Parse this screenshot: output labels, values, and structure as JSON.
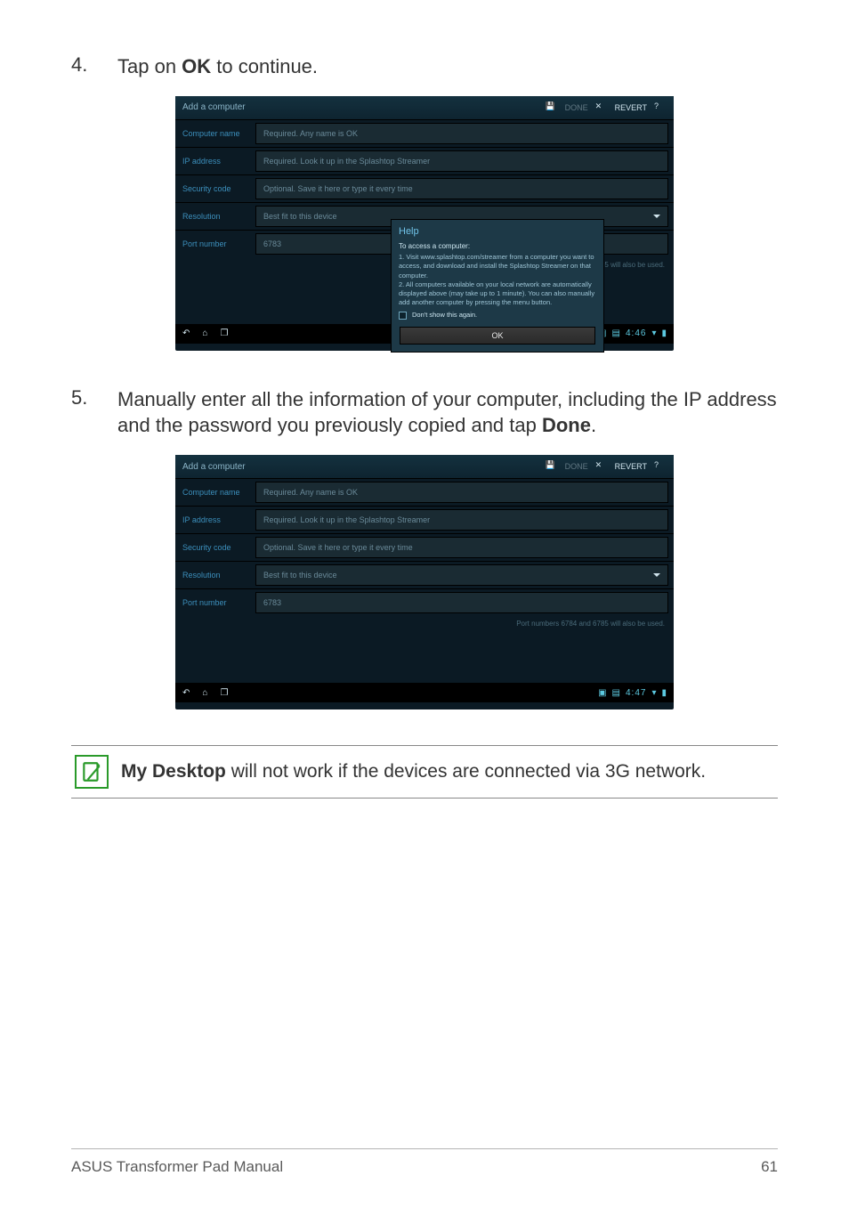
{
  "step4": {
    "num": "4.",
    "text_before": "Tap on ",
    "bold": "OK",
    "text_after": " to continue."
  },
  "step5": {
    "num": "5.",
    "text_before": "Manually enter all the information of your computer, including the IP address and the password you previously copied and tap ",
    "bold": "Done",
    "text_after": "."
  },
  "shot": {
    "title": "Add a computer",
    "save_icon": "💾",
    "done_label": "DONE",
    "revert_label": "REVERT",
    "help_label": "?",
    "x_label": "✕",
    "rows": {
      "computer_name": {
        "label": "Computer name",
        "placeholder": "Required. Any name is OK"
      },
      "ip_address": {
        "label": "IP address",
        "placeholder": "Required. Look it up in the Splashtop Streamer"
      },
      "security_code": {
        "label": "Security code",
        "placeholder": "Optional. Save it here or type it every time"
      },
      "resolution": {
        "label": "Resolution",
        "value": "Best fit to this device"
      },
      "port_number": {
        "label": "Port number",
        "value": "6783"
      }
    },
    "port_note": "Port numbers 6784 and 6785 will also be used.",
    "nav": {
      "back": "↶",
      "home": "⌂",
      "recent": "❐"
    },
    "status1": {
      "clock": "4:46",
      "wifi": "▾",
      "batt": "▮"
    },
    "status2": {
      "clock": "4:47",
      "wifi": "▾",
      "batt": "▮"
    }
  },
  "help": {
    "title": "Help",
    "subtitle": "To access a computer:",
    "line1": "1. Visit www.splashtop.com/streamer from a computer you want to access, and download and install the Splashtop Streamer on that computer.",
    "line2": "2. All computers available on your local network are automatically displayed above (may take up to 1 minute). You can also manually add another computer by pressing the menu button.",
    "dont_show": "Don't show this again.",
    "ok": "OK"
  },
  "note": {
    "bold": "My Desktop",
    "text": " will not work if the devices are connected via 3G network."
  },
  "footer": {
    "left": "ASUS Transformer Pad Manual",
    "right": "61"
  }
}
